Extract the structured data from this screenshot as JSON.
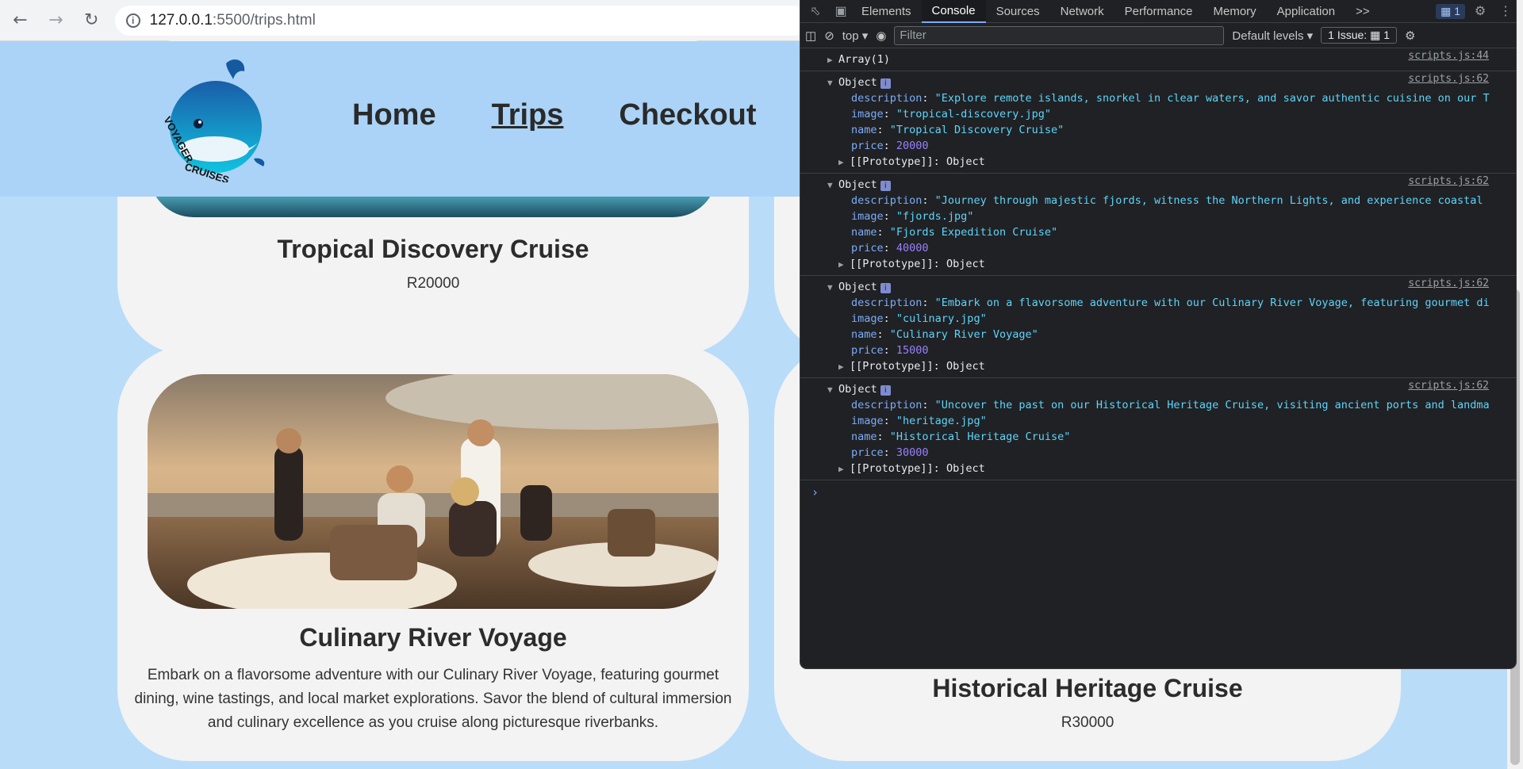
{
  "browser": {
    "url_host": "127.0.0.1",
    "url_path": ":5500/trips.html"
  },
  "header": {
    "logo_text": "VOYAGER CRUISES",
    "nav": [
      {
        "label": "Home"
      },
      {
        "label": "Trips"
      },
      {
        "label": "Checkout"
      }
    ]
  },
  "cards": [
    {
      "title": "Tropical Discovery Cruise",
      "price": "R20000"
    },
    {
      "title": "Culinary River Voyage",
      "description": "Embark on a flavorsome adventure with our Culinary River Voyage, featuring gourmet dining, wine tastings, and local market explorations. Savor the blend of cultural immersion and culinary excellence as you cruise along picturesque riverbanks."
    },
    {
      "title": "Historical Heritage Cruise",
      "price": "R30000"
    }
  ],
  "devtools": {
    "tabs": [
      "Elements",
      "Console",
      "Sources",
      "Network",
      "Performance",
      "Memory",
      "Application"
    ],
    "active_tab": "Console",
    "more": ">>",
    "badge_count": "1",
    "context": "top",
    "filter_placeholder": "Filter",
    "levels": "Default levels",
    "issues": "1 Issue:",
    "issues_count": "1",
    "console": [
      {
        "type": "array",
        "text": "Array(1)",
        "source": "scripts.js:44"
      },
      {
        "type": "object",
        "source": "scripts.js:62",
        "description": "\"Explore remote islands, snorkel in clear waters, and savor authentic cuisine on our T",
        "image": "\"tropical-discovery.jpg\"",
        "name": "\"Tropical Discovery Cruise\"",
        "price": "20000"
      },
      {
        "type": "object",
        "source": "scripts.js:62",
        "description": "\"Journey through majestic fjords, witness the Northern Lights, and experience coastal",
        "image": "\"fjords.jpg\"",
        "name": "\"Fjords Expedition Cruise\"",
        "price": "40000"
      },
      {
        "type": "object",
        "source": "scripts.js:62",
        "description": "\"Embark on a flavorsome adventure with our Culinary River Voyage, featuring gourmet di",
        "image": "\"culinary.jpg\"",
        "name": "\"Culinary River Voyage\"",
        "price": "15000"
      },
      {
        "type": "object",
        "source": "scripts.js:62",
        "description": "\"Uncover the past on our Historical Heritage Cruise, visiting ancient ports and landma",
        "image": "\"heritage.jpg\"",
        "name": "\"Historical Heritage Cruise\"",
        "price": "30000"
      }
    ],
    "labels": {
      "object": "Object",
      "prototype_key": "[[Prototype]]",
      "prototype_val": "Object",
      "description": "description",
      "image": "image",
      "name": "name",
      "price": "price"
    }
  }
}
